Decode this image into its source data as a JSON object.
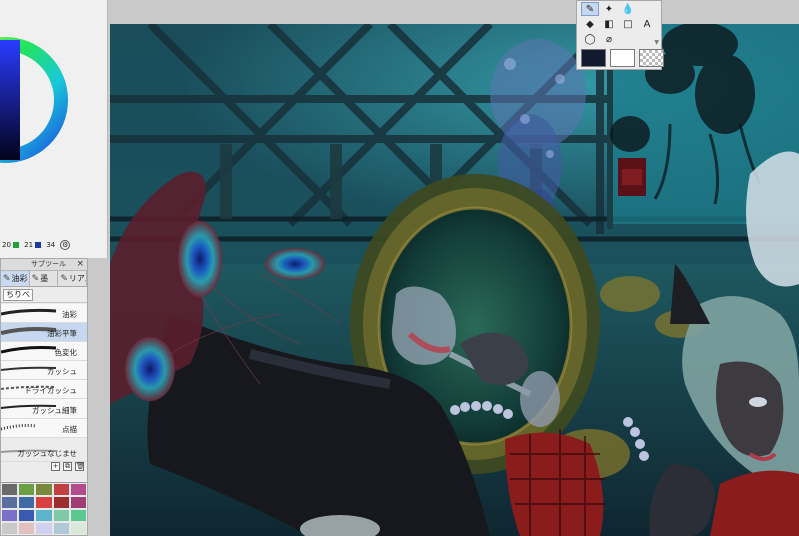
{
  "app": "Clip Studio Paint",
  "color_wheel": {
    "current_color": "#0b0f70",
    "palette_numbers": [
      "20",
      "21",
      "34"
    ]
  },
  "subtool": {
    "title": "サブツール",
    "close": "×",
    "tabs": [
      {
        "icon": "brush-icon",
        "label": "油彩"
      },
      {
        "icon": "brush-icon",
        "label": "墨"
      },
      {
        "icon": "brush-icon",
        "label": "リアル"
      }
    ],
    "group": "ちりべ",
    "brushes": [
      {
        "label": "油彩"
      },
      {
        "label": "油彩平筆",
        "selected": true
      },
      {
        "label": "色変化"
      },
      {
        "label": "ガッシュ"
      },
      {
        "label": "ドライガッシュ"
      },
      {
        "label": "ガッシュ細筆"
      },
      {
        "label": "点描"
      },
      {
        "label": "ガッシュなじませ"
      }
    ],
    "actions": {
      "add": "+",
      "copy": "⧉",
      "delete": "🗑"
    },
    "swatches": [
      "#6a6a6a",
      "#6aa043",
      "#7a8a3a",
      "#c24040",
      "#b44b8c",
      "#5a6f9e",
      "#3f6aa5",
      "#d84040",
      "#9b2d2d",
      "#a03d73",
      "#7a6fc9",
      "#3a5ab0",
      "#5bb5ca",
      "#7fc9a8",
      "#5bc98f",
      "#c9c9c9",
      "#e2c0c0",
      "#d0d0ef",
      "#b0c9d7",
      "#d9e8d9"
    ]
  },
  "tool_palette": {
    "tools": [
      {
        "icon": "brush-tool-icon",
        "glyph": "✎",
        "active": true
      },
      {
        "icon": "sparkle-tool-icon",
        "glyph": "✦"
      },
      {
        "icon": "water-drop-icon",
        "glyph": "💧"
      },
      {
        "icon": "blank",
        "glyph": ""
      },
      {
        "icon": "fill-bucket-icon",
        "glyph": "◆"
      },
      {
        "icon": "gradient-icon",
        "glyph": "◧"
      },
      {
        "icon": "shape-icon",
        "glyph": "□"
      },
      {
        "icon": "text-icon",
        "glyph": "A"
      },
      {
        "icon": "lasso-icon",
        "glyph": "◯"
      },
      {
        "icon": "eyedropper-icon",
        "glyph": "⌀"
      }
    ],
    "main_color": "#111a2e",
    "sub_color": "#ffffff"
  }
}
